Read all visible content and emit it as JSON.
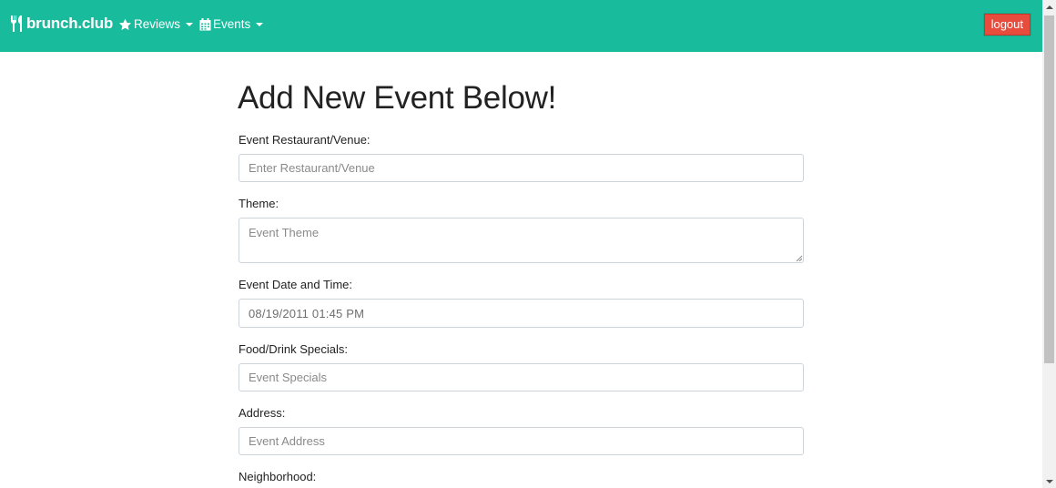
{
  "navbar": {
    "brand": "brunch.club",
    "reviews_label": "Reviews",
    "events_label": "Events",
    "logout_label": "logout",
    "color": "#18bc9c"
  },
  "form": {
    "title": "Add New Event Below!",
    "venue": {
      "label": "Event Restaurant/Venue:",
      "placeholder": "Enter Restaurant/Venue"
    },
    "theme": {
      "label": "Theme:",
      "placeholder": "Event Theme"
    },
    "datetime": {
      "label": "Event Date and Time:",
      "value": "08/19/2011 01:45 PM"
    },
    "specials": {
      "label": "Food/Drink Specials:",
      "placeholder": "Event Specials"
    },
    "address": {
      "label": "Address:",
      "placeholder": "Event Address"
    },
    "neighborhood": {
      "label": "Neighborhood:"
    }
  },
  "icons": {
    "brand": "utensils-icon",
    "reviews": "star-icon",
    "events": "calendar-icon"
  },
  "colors": {
    "logout": "#e74c3c"
  }
}
